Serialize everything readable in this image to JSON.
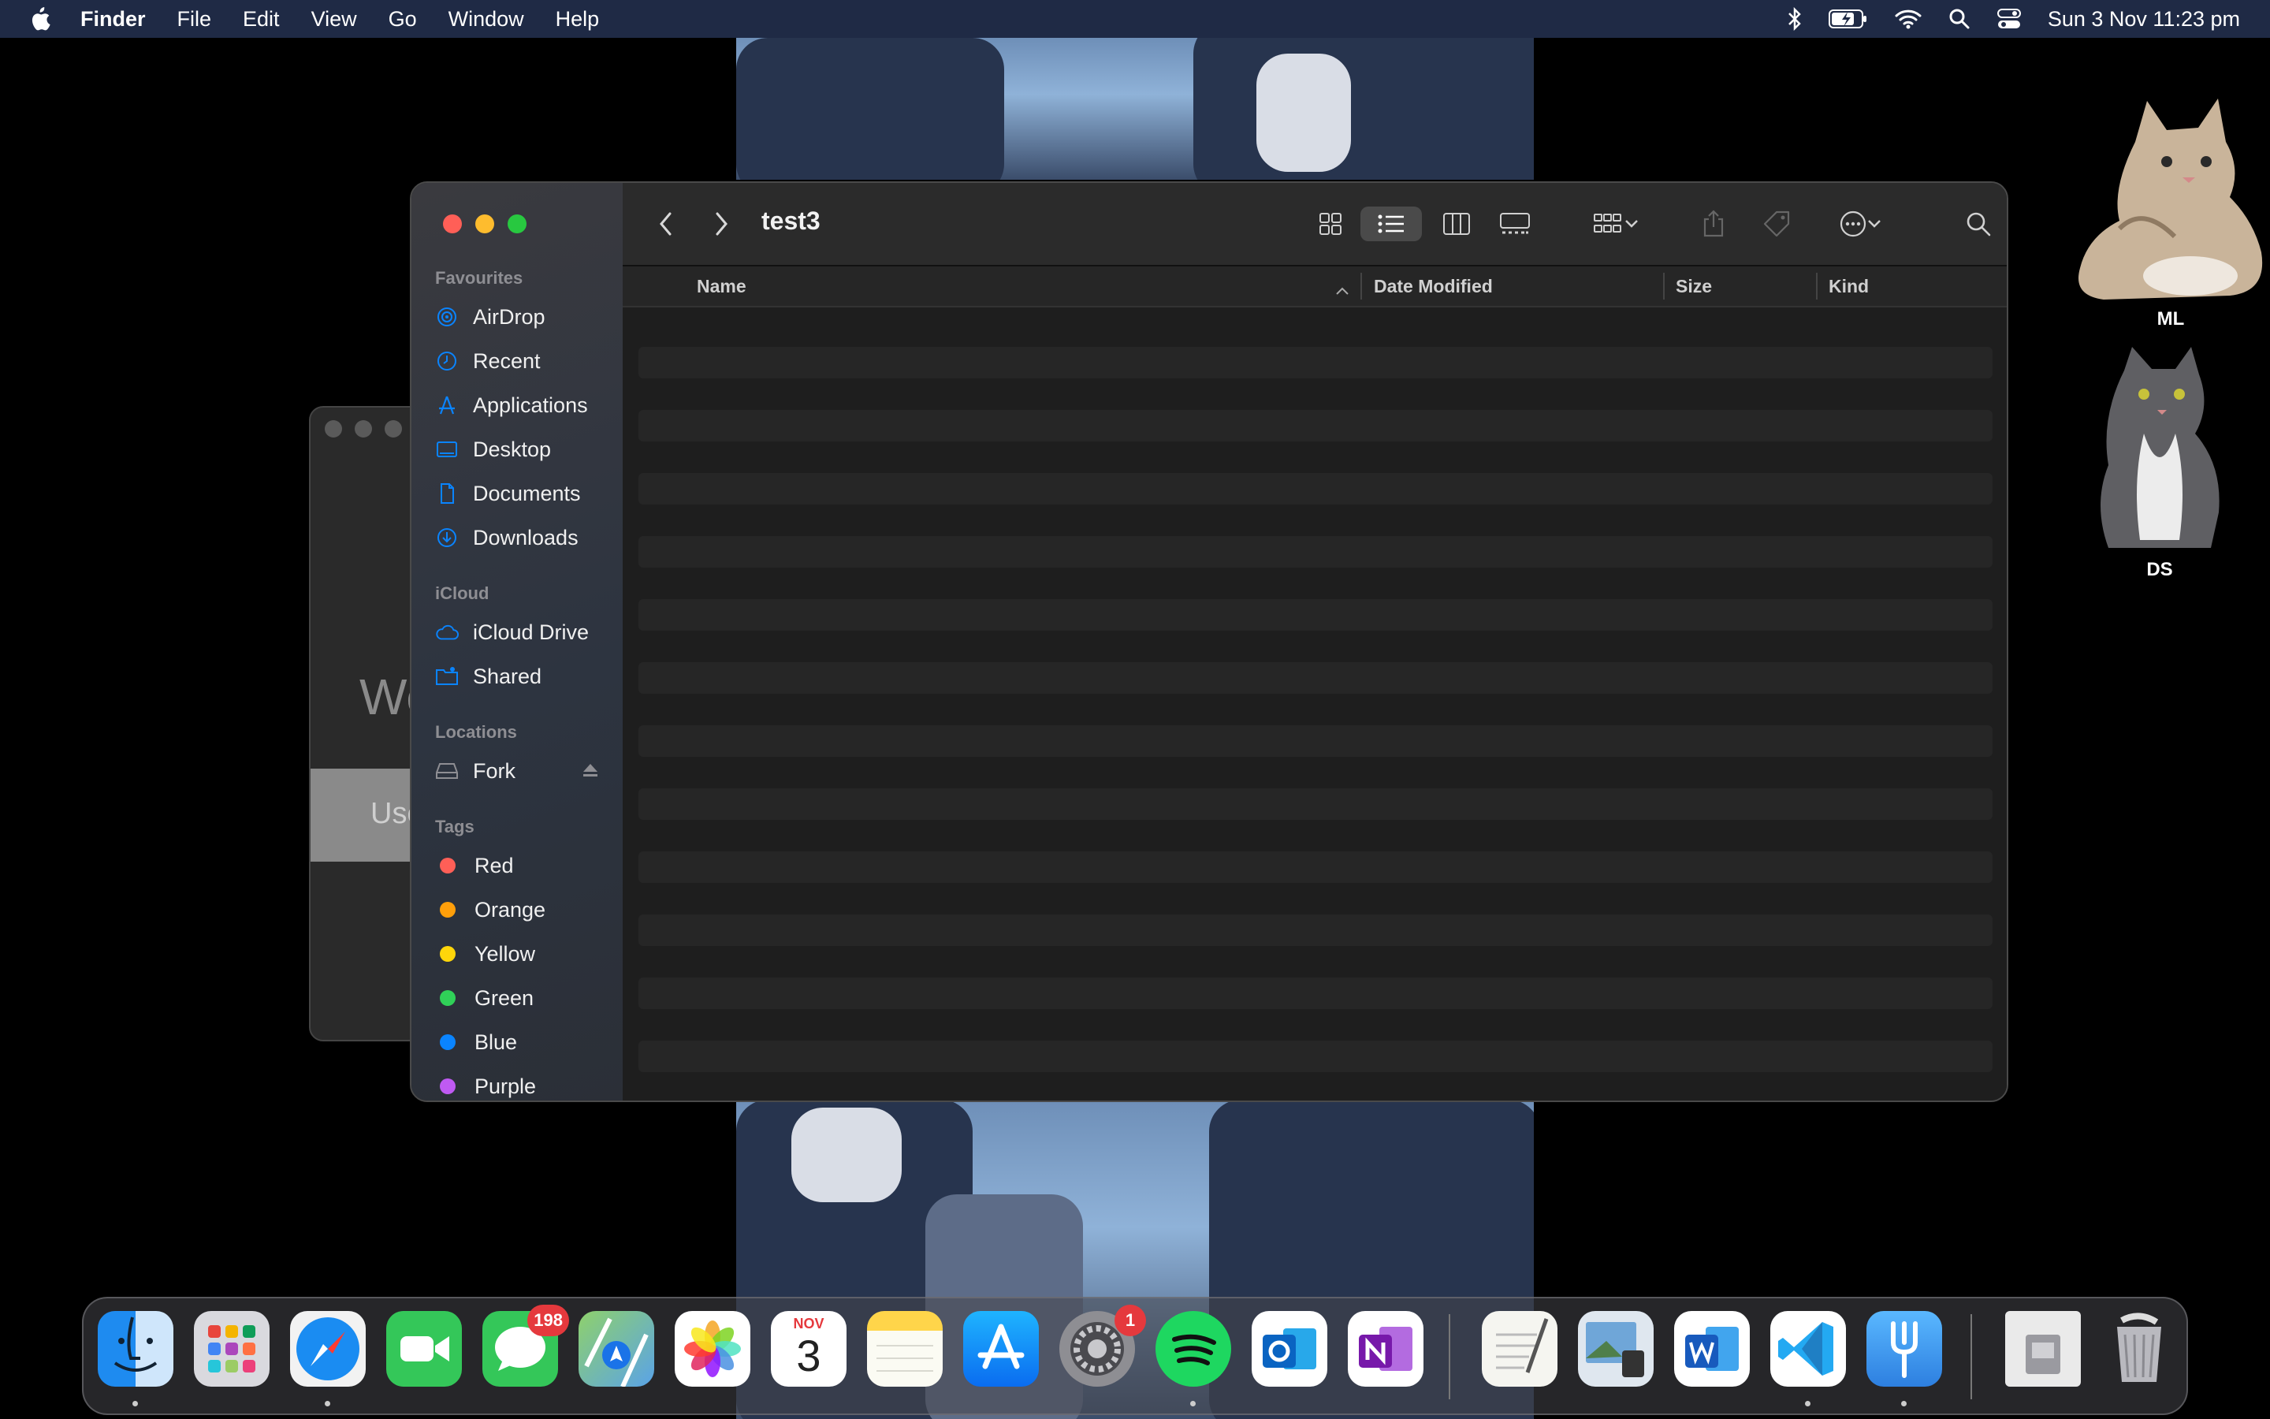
{
  "menubar": {
    "app": "Finder",
    "items": [
      "File",
      "Edit",
      "View",
      "Go",
      "Window",
      "Help"
    ],
    "clock": "Sun 3 Nov  11:23 pm"
  },
  "background_window": {
    "text": "We",
    "bar_text": "Use"
  },
  "finder": {
    "title": "test3",
    "sidebar": {
      "favourites_title": "Favourites",
      "favourites": [
        "AirDrop",
        "Recent",
        "Applications",
        "Desktop",
        "Documents",
        "Downloads"
      ],
      "icloud_title": "iCloud",
      "icloud": [
        "iCloud Drive",
        "Shared"
      ],
      "locations_title": "Locations",
      "locations": [
        "Fork"
      ],
      "tags_title": "Tags",
      "tags": [
        {
          "label": "Red",
          "color": "#ff5f57"
        },
        {
          "label": "Orange",
          "color": "#ff9f0a"
        },
        {
          "label": "Yellow",
          "color": "#ffd60a"
        },
        {
          "label": "Green",
          "color": "#30d158"
        },
        {
          "label": "Blue",
          "color": "#0a84ff"
        },
        {
          "label": "Purple",
          "color": "#bf5af2"
        }
      ]
    },
    "columns": {
      "name": "Name",
      "date": "Date Modified",
      "size": "Size",
      "kind": "Kind"
    }
  },
  "desktop_icons": [
    "ML",
    "DS"
  ],
  "dock": {
    "messages_badge": "198",
    "settings_badge": "1",
    "calendar_month": "NOV",
    "calendar_day": "3"
  },
  "colors": {
    "accent": "#0a84ff",
    "close": "#ff5f57",
    "minimize": "#febc2e",
    "zoom": "#28c840"
  }
}
